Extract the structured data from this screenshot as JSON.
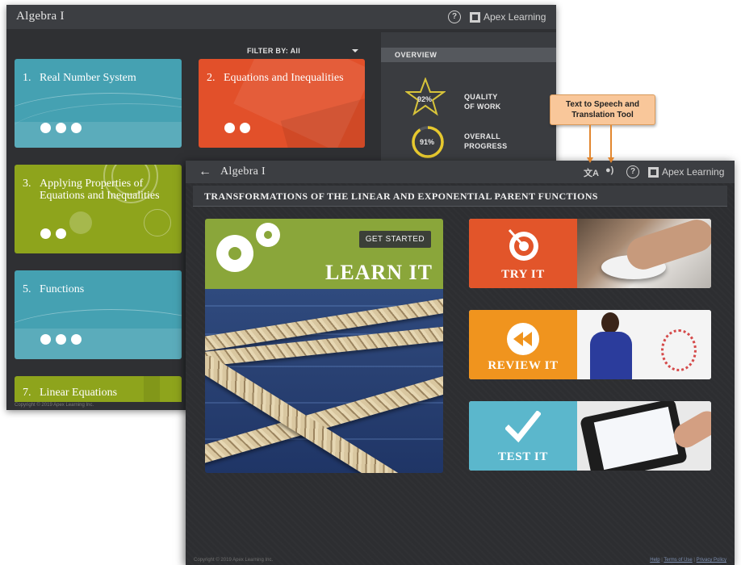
{
  "back_window": {
    "app_title": "Algebra I",
    "brand": "Apex Learning",
    "filter_label": "FILTER BY: All",
    "units": [
      {
        "number": "1.",
        "name": "Real Number System",
        "color": "#45a1b2",
        "dot_count": 3
      },
      {
        "number": "2.",
        "name": "Equations and Inequalities",
        "color": "#e2502a",
        "dot_count": 2
      },
      {
        "number": "3.",
        "name": "Applying Properties of Equations and Inequalities",
        "color": "#8ea41c",
        "dot_count": 2
      },
      {
        "number": "5.",
        "name": "Functions",
        "color": "#45a1b2",
        "dot_count": 3
      },
      {
        "number": "7.",
        "name": "Linear Equations",
        "color": "#8ea41c",
        "dot_count": 0
      }
    ],
    "overview": {
      "header": "OVERVIEW",
      "quality_value": "92%",
      "quality_label_1": "QUALITY",
      "quality_label_2": "OF WORK",
      "progress_value": "91%",
      "progress_fraction": 0.91,
      "progress_label_1": "OVERALL",
      "progress_label_2": "PROGRESS"
    },
    "copyright": "Copyright © 2019 Apex Learning Inc."
  },
  "front_window": {
    "app_title": "Algebra I",
    "brand": "Apex Learning",
    "lesson_title": "TRANSFORMATIONS OF THE LINEAR AND EXPONENTIAL PARENT FUNCTIONS",
    "learn_it": {
      "button": "GET STARTED",
      "label": "LEARN IT",
      "color": "#8aa63a"
    },
    "activities": [
      {
        "label": "TRY IT",
        "color": "#e2552a",
        "icon": "target-icon"
      },
      {
        "label": "REVIEW IT",
        "color": "#f0941e",
        "icon": "rewind-icon"
      },
      {
        "label": "TEST IT",
        "color": "#5bb7cc",
        "icon": "checkmark-icon"
      }
    ],
    "copyright": "Copyright © 2019 Apex Learning Inc.",
    "footer_links": [
      "Help",
      "Terms of Use",
      "Privacy Policy"
    ]
  },
  "callout": {
    "line1": "Text to Speech and",
    "line2": "Translation Tool",
    "color": "#f9c79a"
  }
}
